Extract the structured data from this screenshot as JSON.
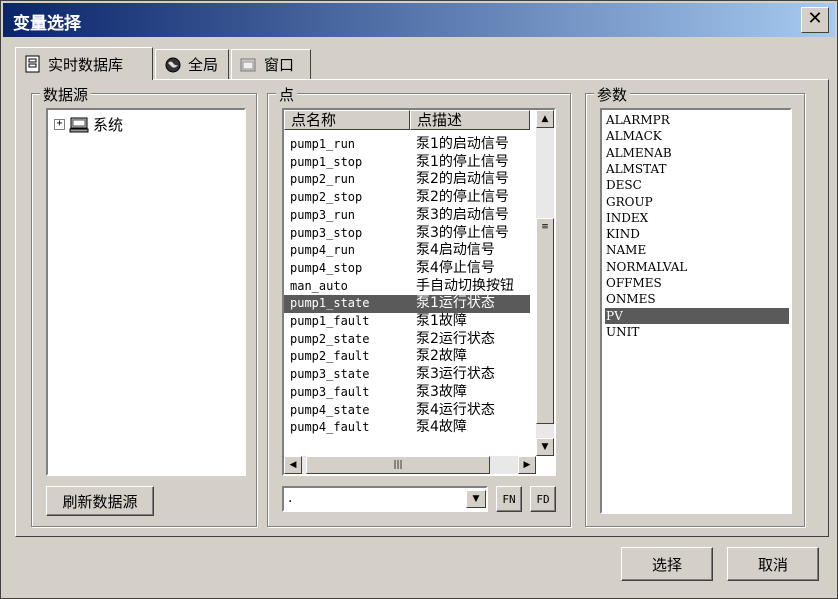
{
  "window": {
    "title": "变量选择"
  },
  "tabs": [
    {
      "label": "实时数据库",
      "icon": "database-icon"
    },
    {
      "label": "全局",
      "icon": "globe-icon"
    },
    {
      "label": "窗口",
      "icon": "window-icon"
    }
  ],
  "datasource": {
    "label": "数据源",
    "tree": [
      {
        "label": "系统",
        "icon": "computer-icon",
        "expander": "+"
      }
    ],
    "refresh_label": "刷新数据源"
  },
  "points": {
    "label": "点",
    "columns": [
      "点名称",
      "点描述"
    ],
    "rows": [
      {
        "name": "pump1_run",
        "desc": "泵1的启动信号"
      },
      {
        "name": "pump1_stop",
        "desc": "泵1的停止信号"
      },
      {
        "name": "pump2_run",
        "desc": "泵2的启动信号"
      },
      {
        "name": "pump2_stop",
        "desc": "泵2的停止信号"
      },
      {
        "name": "pump3_run",
        "desc": "泵3的启动信号"
      },
      {
        "name": "pump3_stop",
        "desc": "泵3的停止信号"
      },
      {
        "name": "pump4_run",
        "desc": "泵4启动信号"
      },
      {
        "name": "pump4_stop",
        "desc": "泵4停止信号"
      },
      {
        "name": "man_auto",
        "desc": "手自动切换按钮"
      },
      {
        "name": "pump1_state",
        "desc": "泵1运行状态",
        "selected": true
      },
      {
        "name": "pump1_fault",
        "desc": "泵1故障"
      },
      {
        "name": "pump2_state",
        "desc": "泵2运行状态"
      },
      {
        "name": "pump2_fault",
        "desc": "泵2故障"
      },
      {
        "name": "pump3_state",
        "desc": "泵3运行状态"
      },
      {
        "name": "pump3_fault",
        "desc": "泵3故障"
      },
      {
        "name": "pump4_state",
        "desc": "泵4运行状态"
      },
      {
        "name": "pump4_fault",
        "desc": "泵4故障"
      }
    ],
    "combo_value": ".",
    "fn_label": "FN",
    "fd_label": "FD"
  },
  "params": {
    "label": "参数",
    "items": [
      "ALARMPR",
      "ALMACK",
      "ALMENAB",
      "ALMSTAT",
      "DESC",
      "GROUP",
      "INDEX",
      "KIND",
      "NAME",
      "NORMALVAL",
      "OFFMES",
      "ONMES",
      "PV",
      "UNIT"
    ],
    "selected": "PV"
  },
  "footer": {
    "ok_label": "选择",
    "cancel_label": "取消"
  }
}
